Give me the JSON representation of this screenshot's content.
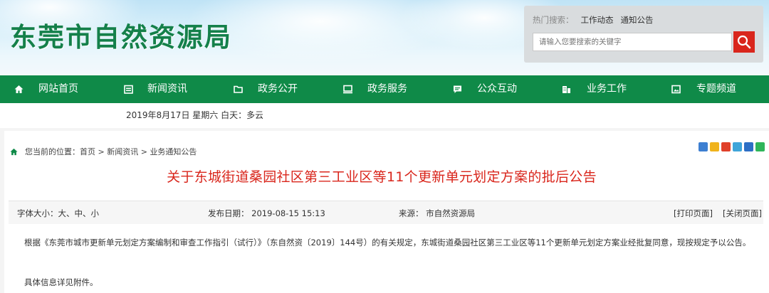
{
  "header": {
    "logo_text": "东莞市自然资源局",
    "hot_search_label": "热门搜索：",
    "hot_links": [
      "工作动态",
      "通知公告"
    ],
    "search_placeholder": "请输入您要搜索的关键字",
    "search_icon": "magnifier-icon"
  },
  "nav": {
    "items": [
      {
        "label": "网站首页",
        "icon": "home-icon"
      },
      {
        "label": "新闻资讯",
        "icon": "calendar-icon"
      },
      {
        "label": "政务公开",
        "icon": "folder-icon"
      },
      {
        "label": "政务服务",
        "icon": "monitor-icon"
      },
      {
        "label": "公众互动",
        "icon": "chat-icon"
      },
      {
        "label": "业务工作",
        "icon": "building-icon"
      },
      {
        "label": "专题频道",
        "icon": "image-icon"
      }
    ]
  },
  "date_bar": {
    "text": "2019年8月17日 星期六 白天：多云"
  },
  "breadcrumb": {
    "prefix": "您当前的位置：",
    "path": [
      "首页",
      "新闻资讯",
      "业务通知公告"
    ],
    "separator": " > "
  },
  "share_icons": [
    "share-plus-icon",
    "qzone-icon",
    "weibo-icon",
    "pengyou-icon",
    "renren-icon",
    "wechat-icon"
  ],
  "article": {
    "title": "关于东城街道桑园社区第三工业区等11个更新单元划定方案的批后公告",
    "font_size_label": "字体大小：",
    "font_sizes": [
      "大",
      "中",
      "小"
    ],
    "publish_date_label": "发布日期：",
    "publish_date": "2019-08-15 15:13",
    "source_label": "来源：",
    "source": "市自然资源局",
    "print_link": "[打印页面]",
    "close_link": "[关闭页面]",
    "body": "根据《东莞市城市更新单元划定方案编制和审查工作指引（试行）》（东自然资〔2019〕144号）的有关规定，东城街道桑园社区第三工业区等11个更新单元划定方案业经批复同意，现按规定予以公告。",
    "body2": "具体信息详见附件。"
  },
  "colors": {
    "brand_green": "#0f8a48",
    "title_red": "#d9261c",
    "search_button": "#d9261c"
  }
}
